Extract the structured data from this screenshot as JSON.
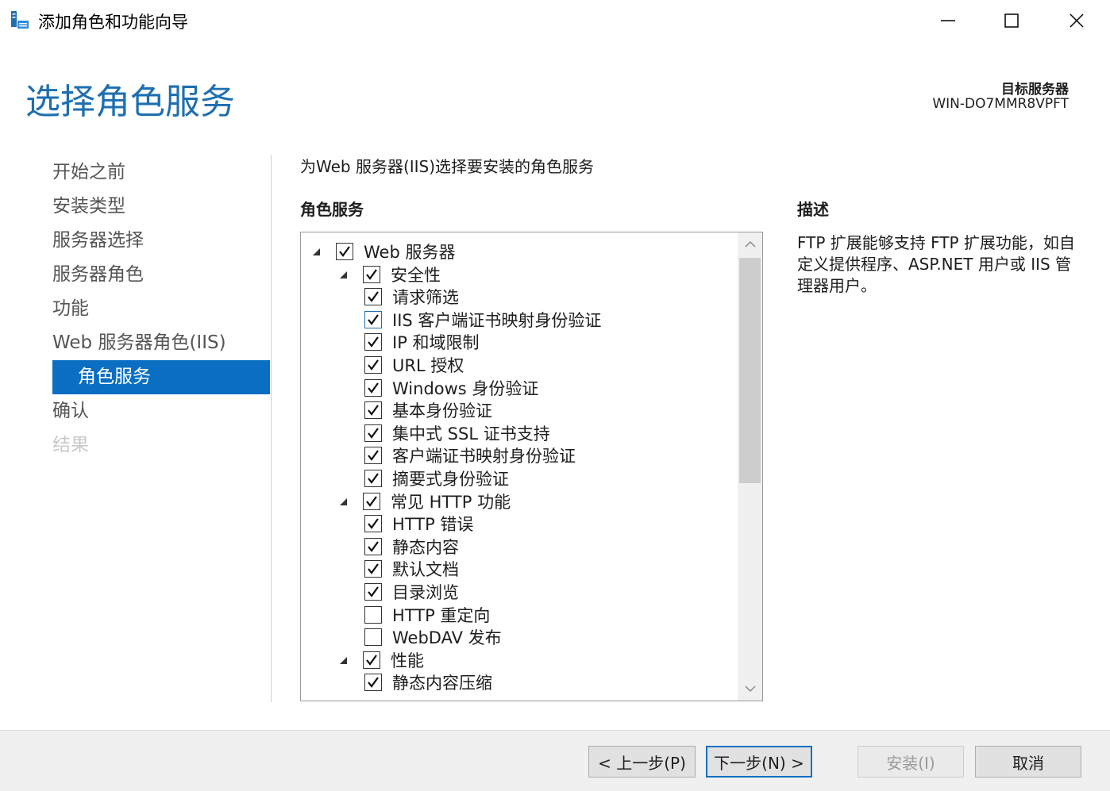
{
  "window": {
    "title": "添加角色和功能向导",
    "icon": "server-manager-icon"
  },
  "header": {
    "page_title": "选择角色服务",
    "target_label": "目标服务器",
    "target_name": "WIN-DO7MMR8VPFT"
  },
  "nav": {
    "items": [
      {
        "label": "开始之前",
        "state": "normal"
      },
      {
        "label": "安装类型",
        "state": "normal"
      },
      {
        "label": "服务器选择",
        "state": "normal"
      },
      {
        "label": "服务器角色",
        "state": "normal"
      },
      {
        "label": "功能",
        "state": "normal"
      },
      {
        "label": "Web 服务器角色(IIS)",
        "state": "normal"
      },
      {
        "label": "角色服务",
        "state": "active"
      },
      {
        "label": "确认",
        "state": "normal"
      },
      {
        "label": "结果",
        "state": "disabled"
      }
    ]
  },
  "main": {
    "instruction": "为Web 服务器(IIS)选择要安装的角色服务",
    "section_header": "角色服务",
    "tree": [
      {
        "label": "Web 服务器",
        "level": 0,
        "checked": true,
        "expanded": true
      },
      {
        "label": "安全性",
        "level": 1,
        "checked": true,
        "expanded": true
      },
      {
        "label": "请求筛选",
        "level": 2,
        "checked": true
      },
      {
        "label": "IIS 客户端证书映射身份验证",
        "level": 2,
        "checked": true,
        "focused": true
      },
      {
        "label": "IP 和域限制",
        "level": 2,
        "checked": true
      },
      {
        "label": "URL 授权",
        "level": 2,
        "checked": true
      },
      {
        "label": "Windows 身份验证",
        "level": 2,
        "checked": true
      },
      {
        "label": "基本身份验证",
        "level": 2,
        "checked": true
      },
      {
        "label": "集中式 SSL 证书支持",
        "level": 2,
        "checked": true
      },
      {
        "label": "客户端证书映射身份验证",
        "level": 2,
        "checked": true
      },
      {
        "label": "摘要式身份验证",
        "level": 2,
        "checked": true
      },
      {
        "label": "常见 HTTP 功能",
        "level": 1,
        "checked": true,
        "expanded": true
      },
      {
        "label": "HTTP 错误",
        "level": 2,
        "checked": true
      },
      {
        "label": "静态内容",
        "level": 2,
        "checked": true
      },
      {
        "label": "默认文档",
        "level": 2,
        "checked": true
      },
      {
        "label": "目录浏览",
        "level": 2,
        "checked": true
      },
      {
        "label": "HTTP 重定向",
        "level": 2,
        "checked": false
      },
      {
        "label": "WebDAV 发布",
        "level": 2,
        "checked": false
      },
      {
        "label": "性能",
        "level": 1,
        "checked": true,
        "expanded": true
      },
      {
        "label": "静态内容压缩",
        "level": 2,
        "checked": true
      }
    ]
  },
  "description": {
    "header": "描述",
    "text": "FTP 扩展能够支持 FTP 扩展功能，如自定义提供程序、ASP.NET 用户或 IIS 管理器用户。"
  },
  "footer": {
    "prev_label": "< 上一步(P)",
    "next_label": "下一步(N) >",
    "install_label": "安装(I)",
    "cancel_label": "取消"
  },
  "colors": {
    "accent": "#0a6fc2",
    "title": "#1e6fb0"
  }
}
